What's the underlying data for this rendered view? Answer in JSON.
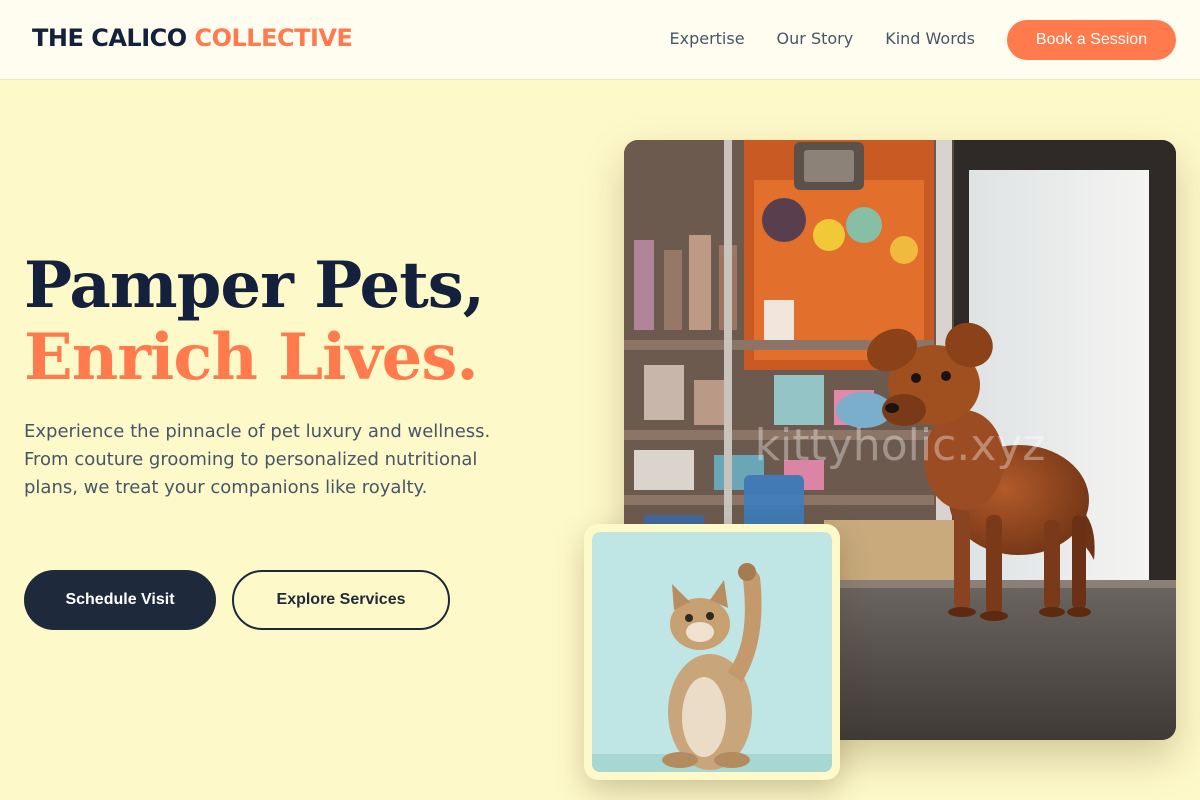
{
  "brand": {
    "name_part1": "THE CALICO",
    "name_part2": "COLLECTIVE"
  },
  "nav": {
    "links": [
      {
        "label": "Expertise"
      },
      {
        "label": "Our Story"
      },
      {
        "label": "Kind Words"
      }
    ],
    "cta_label": "Book a Session"
  },
  "hero": {
    "headline_line1": "Pamper Pets,",
    "headline_line2": "Enrich Lives.",
    "description": "Experience the pinnacle of pet luxury and wellness. From couture grooming to personalized nutritional plans, we treat your companions like royalty.",
    "primary_button": "Schedule Visit",
    "secondary_button": "Explore Services"
  },
  "images": {
    "main_photo": {
      "subject": "dog in pet store",
      "watermark": "kittyholic.xyz"
    },
    "inset_photo": {
      "subject": "kitten raising paw"
    }
  },
  "colors": {
    "background": "#fef9c9",
    "accent": "#ff7a4c",
    "dark": "#1e293b",
    "navy_text": "#14213d"
  }
}
